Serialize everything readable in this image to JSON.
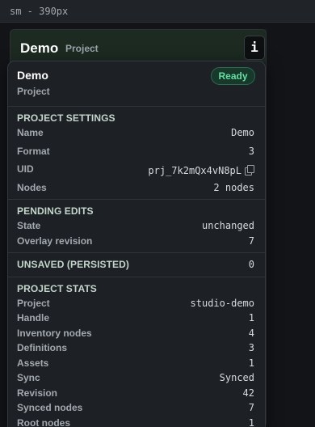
{
  "topbar": {
    "label": "sm - 390px"
  },
  "card": {
    "title": "Demo",
    "subtitle": "Project",
    "info_button": "i"
  },
  "popover": {
    "title": "Demo",
    "subtitle": "Project",
    "status": "Ready",
    "project_settings": {
      "heading": "PROJECT SETTINGS",
      "rows": [
        {
          "key": "Name",
          "value": "Demo"
        },
        {
          "key": "Format",
          "value": "3"
        },
        {
          "key": "UID",
          "value": "prj_7k2mQx4vN8pL"
        },
        {
          "key": "Nodes",
          "value": "2 nodes"
        }
      ]
    },
    "pending_edits": {
      "heading": "PENDING EDITS",
      "rows": [
        {
          "key": "State",
          "value": "unchanged"
        },
        {
          "key": "Overlay revision",
          "value": "7"
        }
      ]
    },
    "unsaved": {
      "heading": "UNSAVED (PERSISTED)",
      "value": "0"
    },
    "project_stats": {
      "heading": "PROJECT STATS",
      "rows": [
        {
          "key": "Project",
          "value": "studio-demo"
        },
        {
          "key": "Handle",
          "value": "1"
        },
        {
          "key": "Inventory nodes",
          "value": "4"
        },
        {
          "key": "Definitions",
          "value": "3"
        },
        {
          "key": "Assets",
          "value": "1"
        },
        {
          "key": "Sync",
          "value": "Synced"
        },
        {
          "key": "Revision",
          "value": "42"
        },
        {
          "key": "Synced nodes",
          "value": "7"
        },
        {
          "key": "Root nodes",
          "value": "1"
        }
      ]
    }
  },
  "colors": {
    "background": "#121418",
    "card": "#1b1e22",
    "popover": "#1d2024",
    "ready_badge_text": "#63e0a0",
    "section_heading": "#c4d6cb"
  },
  "icons": {
    "copy": "copy-icon"
  }
}
